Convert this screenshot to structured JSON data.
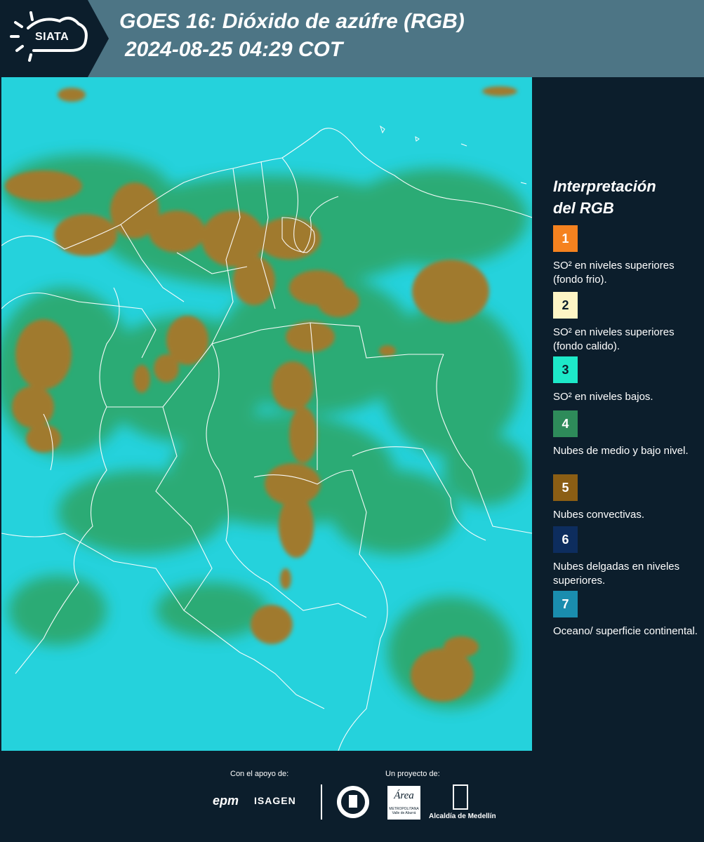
{
  "header": {
    "logo_text": "SIATA",
    "title_line1": "GOES 16: Dióxido de azúfre (RGB)",
    "title_line2": " 2024-08-25 04:29 COT"
  },
  "map": {
    "icon": "satellite-rgb-map",
    "colors": {
      "ocean": "#25d2dc",
      "low_cloud": "#2e9e52",
      "convective": "#a07a2e"
    }
  },
  "legend": {
    "title_line1": "Interpretación",
    "title_line2": "del RGB",
    "items": [
      {
        "number": "1",
        "color": "#f5821f",
        "text": "SO² en niveles superiores (fondo frio)."
      },
      {
        "number": "2",
        "color": "#fdf5c5",
        "text": "SO² en niveles superiores (fondo calido)."
      },
      {
        "number": "3",
        "color": "#1de9c9",
        "text": "SO² en niveles bajos."
      },
      {
        "number": "4",
        "color": "#2e8b5a",
        "text": "Nubes de medio y bajo nivel."
      },
      {
        "number": "5",
        "color": "#8b5e14",
        "text": "Nubes convectivas."
      },
      {
        "number": "6",
        "color": "#0d2d5e",
        "text": "Nubes delgadas en niveles superiores."
      },
      {
        "number": "7",
        "color": "#1a8dae",
        "text": "Oceano/ superficie continental."
      }
    ]
  },
  "footer": {
    "support_label": "Con el apoyo de:",
    "project_label": "Un proyecto de:",
    "epm": "epm",
    "isagen": "ISAGEN",
    "area_logo": "Área",
    "area_sub": "METROPOLITANA Valle de Aburrá",
    "alcaldia": "Alcaldía de Medellín"
  }
}
